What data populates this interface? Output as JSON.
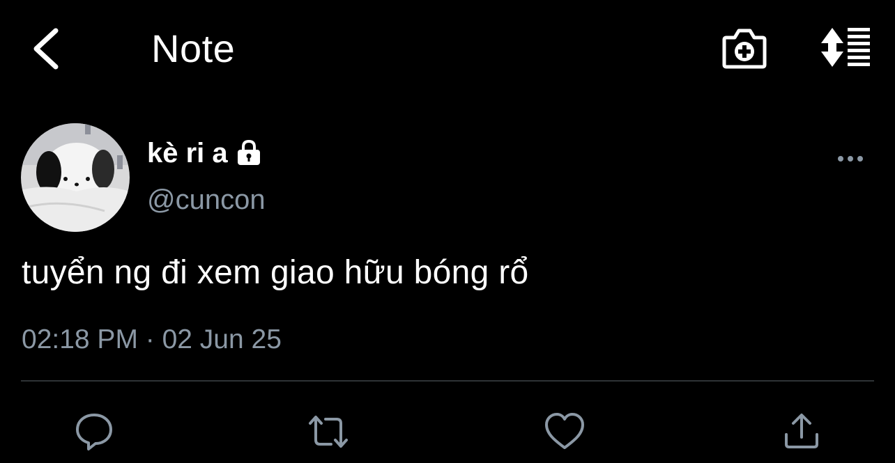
{
  "header": {
    "title": "Note",
    "icons": {
      "back": "chevron-left-icon",
      "camera": "camera-add-icon",
      "sort": "sort-list-icon"
    }
  },
  "tweet": {
    "display_name": "kè ri a",
    "handle": "@cuncon",
    "protected": true,
    "text": "tuyển ng đi xem giao hữu bóng rổ",
    "timestamp": "02:18 PM · 02 Jun 25"
  },
  "actions": [
    "reply-icon",
    "retweet-icon",
    "like-icon",
    "share-icon"
  ],
  "colors": {
    "background": "#000000",
    "text": "#ffffff",
    "secondary_text": "#8b98a5",
    "divider": "#2f3336"
  }
}
